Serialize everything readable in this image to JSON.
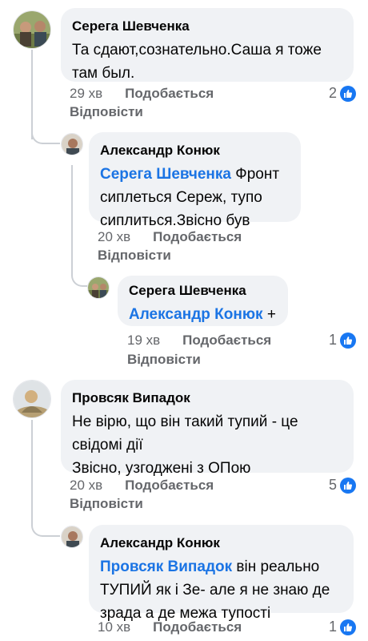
{
  "comments": [
    {
      "author": "Серега Шевченка",
      "text": "Та сдают,сознательно.Саша я тоже там был.",
      "time": "29 хв",
      "like_label": "Подобається",
      "reply_label": "Відповісти",
      "reactions": "2"
    },
    {
      "author": "Александр Конюк",
      "mention": "Серега Шевченка",
      "text": " Фронт сиплеться Сереж, тупо сиплиться.Звісно був",
      "time": "20 хв",
      "like_label": "Подобається",
      "reply_label": "Відповісти"
    },
    {
      "author": "Серега Шевченка",
      "mention": "Александр Конюк",
      "text": " +",
      "time": "19 хв",
      "like_label": "Подобається",
      "reply_label": "Відповісти",
      "reactions": "1"
    },
    {
      "author": "Провсяк Випадок",
      "text_line1": "Не вірю, що він такий тупий - це свідомі дії",
      "text_line2": "Звісно, узгоджені з ОПою",
      "time": "20 хв",
      "like_label": "Подобається",
      "reply_label": "Відповісти",
      "reactions": "5"
    },
    {
      "author": "Александр Конюк",
      "mention": "Провсяк Випадок",
      "text": " він реально ТУПИЙ як і Зе- але я не знаю де зрада а де межа тупості",
      "time": "10 хв",
      "like_label": "Подобається",
      "reactions": "1"
    }
  ],
  "colors": {
    "mention": "#1b74e4",
    "like_badge": "#1877f2",
    "bubble": "#f0f2f5",
    "meta": "#65676b"
  },
  "icons": {
    "reaction": "thumbs-up-icon"
  }
}
